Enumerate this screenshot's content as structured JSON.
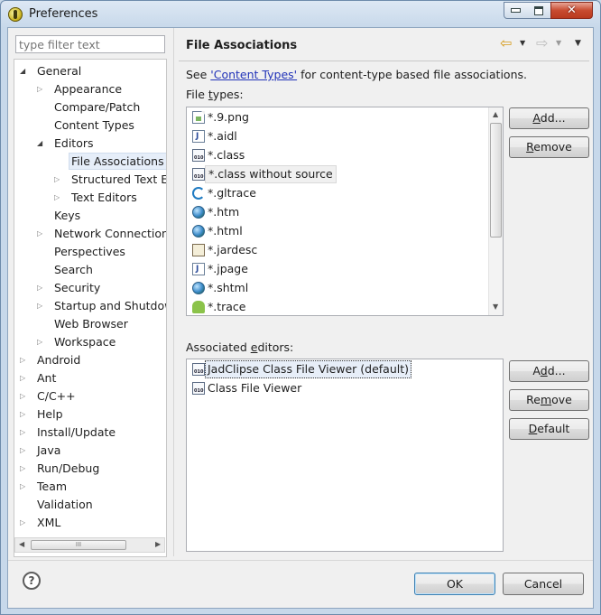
{
  "window": {
    "title": "Preferences"
  },
  "filter": {
    "placeholder": "type filter text"
  },
  "tree": [
    {
      "label": "General",
      "level": 0,
      "twist": "expanded"
    },
    {
      "label": "Appearance",
      "level": 1,
      "twist": "collapsed"
    },
    {
      "label": "Compare/Patch",
      "level": 1,
      "twist": "none"
    },
    {
      "label": "Content Types",
      "level": 1,
      "twist": "none"
    },
    {
      "label": "Editors",
      "level": 1,
      "twist": "expanded"
    },
    {
      "label": "File Associations",
      "level": 2,
      "twist": "none",
      "selected": true
    },
    {
      "label": "Structured Text Ec",
      "level": 2,
      "twist": "collapsed"
    },
    {
      "label": "Text Editors",
      "level": 2,
      "twist": "collapsed"
    },
    {
      "label": "Keys",
      "level": 1,
      "twist": "none"
    },
    {
      "label": "Network Connections",
      "level": 1,
      "twist": "collapsed"
    },
    {
      "label": "Perspectives",
      "level": 1,
      "twist": "none"
    },
    {
      "label": "Search",
      "level": 1,
      "twist": "none"
    },
    {
      "label": "Security",
      "level": 1,
      "twist": "collapsed"
    },
    {
      "label": "Startup and Shutdow",
      "level": 1,
      "twist": "collapsed"
    },
    {
      "label": "Web Browser",
      "level": 1,
      "twist": "none"
    },
    {
      "label": "Workspace",
      "level": 1,
      "twist": "collapsed"
    },
    {
      "label": "Android",
      "level": 0,
      "twist": "collapsed"
    },
    {
      "label": "Ant",
      "level": 0,
      "twist": "collapsed"
    },
    {
      "label": "C/C++",
      "level": 0,
      "twist": "collapsed"
    },
    {
      "label": "Help",
      "level": 0,
      "twist": "collapsed"
    },
    {
      "label": "Install/Update",
      "level": 0,
      "twist": "collapsed"
    },
    {
      "label": "Java",
      "level": 0,
      "twist": "collapsed"
    },
    {
      "label": "Run/Debug",
      "level": 0,
      "twist": "collapsed"
    },
    {
      "label": "Team",
      "level": 0,
      "twist": "collapsed"
    },
    {
      "label": "Validation",
      "level": 0,
      "twist": "none"
    },
    {
      "label": "XML",
      "level": 0,
      "twist": "collapsed"
    }
  ],
  "panel": {
    "title": "File Associations",
    "desc_prefix": "See ",
    "desc_link": "'Content Types'",
    "desc_suffix": " for content-type based file associations.",
    "filetypes_label": "File types:",
    "assoc_label": "Associated editors:"
  },
  "file_types": [
    {
      "label": "*.9.png",
      "icon": "image-file-icon"
    },
    {
      "label": "*.aidl",
      "icon": "java-file-icon"
    },
    {
      "label": "*.class",
      "icon": "class-file-icon"
    },
    {
      "label": "*.class without source",
      "icon": "class-file-icon",
      "selected": true
    },
    {
      "label": "*.gltrace",
      "icon": "gltrace-icon"
    },
    {
      "label": "*.htm",
      "icon": "globe-icon"
    },
    {
      "label": "*.html",
      "icon": "globe-icon"
    },
    {
      "label": "*.jardesc",
      "icon": "jar-icon"
    },
    {
      "label": "*.jpage",
      "icon": "java-file-icon"
    },
    {
      "label": "*.shtml",
      "icon": "globe-icon"
    },
    {
      "label": "*.trace",
      "icon": "android-icon"
    }
  ],
  "editors": [
    {
      "label": "JadClipse Class File Viewer (default)",
      "icon": "class-file-icon",
      "focused": true
    },
    {
      "label": "Class File Viewer",
      "icon": "class-file-icon"
    }
  ],
  "buttons": {
    "add_types": {
      "pre": "",
      "u": "A",
      "post": "dd..."
    },
    "remove_types": {
      "pre": "",
      "u": "R",
      "post": "emove"
    },
    "add_editor": {
      "pre": "A",
      "u": "d",
      "post": "d..."
    },
    "remove_editor": {
      "pre": "Re",
      "u": "m",
      "post": "ove"
    },
    "default": {
      "pre": "",
      "u": "D",
      "post": "efault"
    },
    "ok": "OK",
    "cancel": "Cancel"
  }
}
